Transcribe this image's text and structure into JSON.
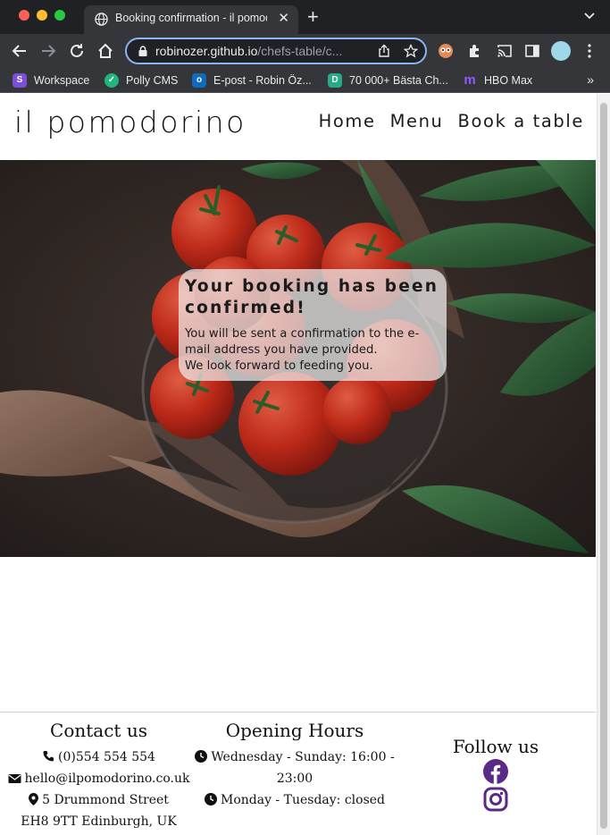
{
  "browser": {
    "tab_title": "Booking confirmation - il pomodorino",
    "url_host": "robinozer.github.io",
    "url_path": "/chefs-table/c...",
    "bookmarks": [
      {
        "label": "Workspace",
        "color": "#7b4fd6",
        "icon": "workspace-icon"
      },
      {
        "label": "Polly CMS",
        "color": "#1fb57b",
        "icon": "polly-icon"
      },
      {
        "label": "E-post - Robin Öz...",
        "color": "#0f6cbd",
        "icon": "outlook-icon"
      },
      {
        "label": "70 000+ Bästa Ch...",
        "color": "#27a98a",
        "icon": "dictionary-icon"
      },
      {
        "label": "HBO Max",
        "color": "#6f2bd9",
        "icon": "hbo-max-icon"
      }
    ],
    "bookmarks_more": "»"
  },
  "site": {
    "brand": "il pomodorino",
    "nav": [
      "Home",
      "Menu",
      "Book a table"
    ]
  },
  "confirmation": {
    "title": "Your booking has been confirmed!",
    "message_line1": "You will be sent a confirmation to the e-mail address you have provided.",
    "message_line2": "We look forward to feeding you."
  },
  "footer": {
    "contact": {
      "heading": "Contact us",
      "phone": "(0)554 554 554",
      "email": "hello@ilpomodorino.co.uk",
      "address_line1": "5 Drummond Street",
      "address_line2": "EH8 9TT Edinburgh, UK"
    },
    "hours": {
      "heading": "Opening Hours",
      "line1a": "Wednesday - Sunday: 16:00 -",
      "line1b": "23:00",
      "line2": "Monday - Tuesday: closed"
    },
    "follow": {
      "heading": "Follow us",
      "accent": "#5b2a86",
      "icons": [
        "facebook-icon",
        "instagram-icon"
      ]
    }
  }
}
